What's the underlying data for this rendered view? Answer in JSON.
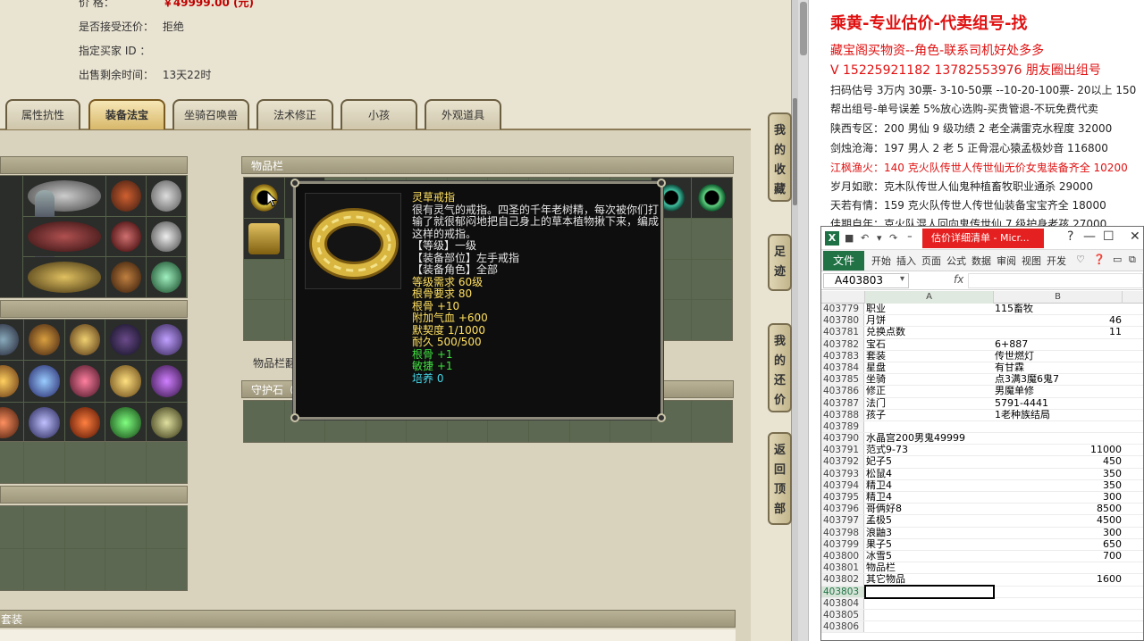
{
  "info": {
    "price_label": "价          格：",
    "price_value": "￥49999.00 (元)",
    "bargain_label": "是否接受还价：",
    "bargain_value": "拒绝",
    "buyer_label": "指定买家 ID ：",
    "buyer_value": "",
    "remain_label": "出售剩余时间：",
    "remain_value": "13天22时"
  },
  "tabs": [
    "属性抗性",
    "装备法宝",
    "坐骑召唤兽",
    "法术修正",
    "小孩",
    "外观道具"
  ],
  "active_tab": "装备法宝",
  "panels": {
    "inventory_title": "物品栏",
    "inventory_extra": "物品栏翻",
    "guardstone_title": "守护石（",
    "bottom_title": "套装"
  },
  "tooltip": {
    "name": "灵草戒指",
    "desc": "很有灵气的戒指。四圣的千年老树精，每次被你们打输了就很郁闷地把自己身上的草本植物揪下来，编成这样的戒指。",
    "level": "【等级】一级",
    "slot": "【装备部位】左手戒指",
    "role": "【装备角色】全部",
    "req_level": "等级需求 60级",
    "req_bone": "根骨要求 80",
    "bone": "根骨 +10",
    "hp": "附加气血 +600",
    "tacit": "默契度 1/1000",
    "durability": "耐久 500/500",
    "bone_green": "根骨 +1",
    "agility_green": "敏捷 +1",
    "cultivate": "培养 0"
  },
  "side_nav": [
    "我的收藏",
    "足迹",
    "我的还价",
    "返回顶部"
  ],
  "ad": {
    "headline": "乘黄-专业估价-代卖组号-找",
    "lines": [
      "藏宝阁买物资--角色-联系司机好处多多",
      "V 15225921182    13782553976 朋友圈出组号",
      "扫码估号 3万内 30票- 3-10-50票  --10-20-100票- 20以上 150",
      "帮出组号-单号误差 5%放心选购-买贵管退-不玩免费代卖",
      "陕西专区：200 男仙 9 级功绩 2 老全满雷克水程度 32000",
      "剑烛沧海：197 男人 2 老 5 正骨混心猿孟极妙音 116800",
      "江枫渔火：140 克火队传世人传世仙无价女鬼装备齐全 10200",
      "岁月如歌：克木队传世人仙鬼种植畜牧职业通杀 29000",
      "天若有情：159 克火队传世人传世仙装备宝宝齐全 18000",
      "佳期自年：克火队混人回向鬼传世仙 7 级护身老孩 27000"
    ]
  },
  "excel": {
    "doc_title": "估价详细清单 - Micr...",
    "ribbon_file": "文件",
    "ribbon_tabs": [
      "开始",
      "插入",
      "页面",
      "公式",
      "数据",
      "审阅",
      "视图",
      "开发"
    ],
    "name_box": "A403803",
    "fx": "fx",
    "col_a": "A",
    "col_b": "B",
    "rows": [
      {
        "n": "403779",
        "a": "职业",
        "b": "115畜牧",
        "num": false
      },
      {
        "n": "403780",
        "a": "月饼",
        "b": "46",
        "num": true
      },
      {
        "n": "403781",
        "a": "兑换点数",
        "b": "11",
        "num": true
      },
      {
        "n": "403782",
        "a": "宝石",
        "b": "6+887",
        "num": false
      },
      {
        "n": "403783",
        "a": "套装",
        "b": "传世燃灯",
        "num": false
      },
      {
        "n": "403784",
        "a": "星盘",
        "b": "有甘霖",
        "num": false
      },
      {
        "n": "403785",
        "a": "坐骑",
        "b": "点3满3魔6鬼7",
        "num": false
      },
      {
        "n": "403786",
        "a": "修正",
        "b": "男魔单修",
        "num": false
      },
      {
        "n": "403787",
        "a": "法门",
        "b": "5791-4441",
        "num": false
      },
      {
        "n": "403788",
        "a": "孩子",
        "b": "1老种族结局",
        "num": false
      },
      {
        "n": "403789",
        "a": "",
        "b": "",
        "num": false
      },
      {
        "n": "403790",
        "a": "水晶宫200男鬼49999",
        "b": "",
        "num": false
      },
      {
        "n": "403791",
        "a": "范式9-73",
        "b": "11000",
        "num": true
      },
      {
        "n": "403792",
        "a": "妃子5",
        "b": "450",
        "num": true
      },
      {
        "n": "403793",
        "a": "松鼠4",
        "b": "350",
        "num": true
      },
      {
        "n": "403794",
        "a": "精卫4",
        "b": "350",
        "num": true
      },
      {
        "n": "403795",
        "a": "精卫4",
        "b": "300",
        "num": true
      },
      {
        "n": "403796",
        "a": "哥俩好8",
        "b": "8500",
        "num": true
      },
      {
        "n": "403797",
        "a": "孟极5",
        "b": "4500",
        "num": true
      },
      {
        "n": "403798",
        "a": "浪鼬3",
        "b": "300",
        "num": true
      },
      {
        "n": "403799",
        "a": "果子5",
        "b": "650",
        "num": true
      },
      {
        "n": "403800",
        "a": "冰雪5",
        "b": "700",
        "num": true
      },
      {
        "n": "403801",
        "a": "物品栏",
        "b": "",
        "num": false
      },
      {
        "n": "403802",
        "a": "其它物品",
        "b": "1600",
        "num": true
      },
      {
        "n": "403803",
        "a": "",
        "b": "",
        "num": false
      },
      {
        "n": "403804",
        "a": "",
        "b": "",
        "num": false
      },
      {
        "n": "403805",
        "a": "",
        "b": "",
        "num": false
      },
      {
        "n": "403806",
        "a": "",
        "b": "",
        "num": false
      }
    ],
    "active_row": "403803"
  }
}
